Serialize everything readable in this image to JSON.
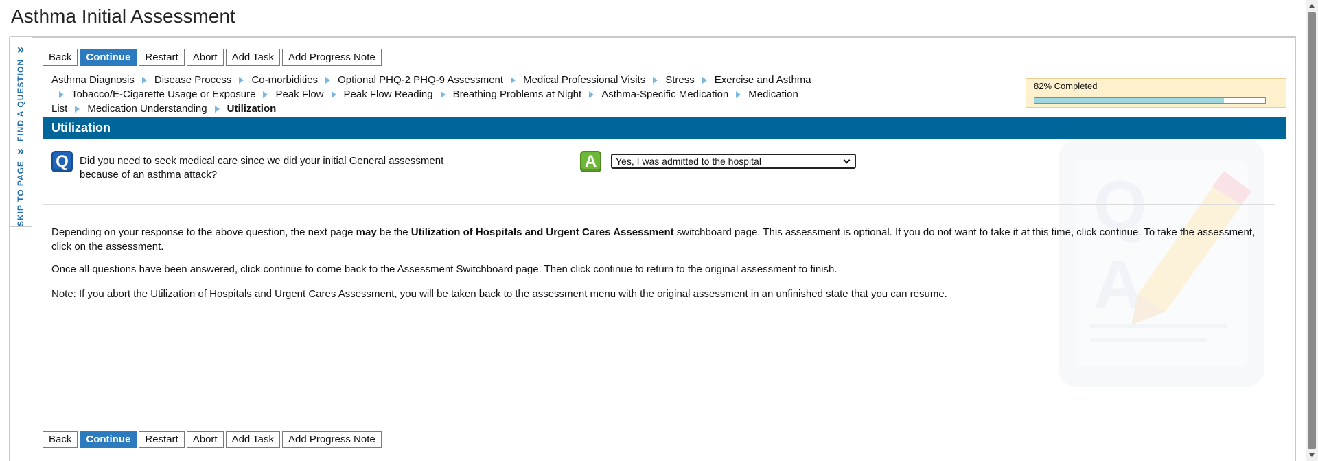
{
  "page": {
    "title": "Asthma Initial Assessment"
  },
  "side_tabs": [
    {
      "label": "FIND A QUESTION"
    },
    {
      "label": "SKIP TO PAGE"
    }
  ],
  "toolbar": {
    "back": "Back",
    "continue": "Continue",
    "restart": "Restart",
    "abort": "Abort",
    "add_task": "Add Task",
    "add_progress_note": "Add Progress Note"
  },
  "breadcrumbs": [
    {
      "label": "Asthma Diagnosis"
    },
    {
      "label": "Disease Process"
    },
    {
      "label": "Co-morbidities"
    },
    {
      "label": "Optional PHQ-2 PHQ-9 Assessment"
    },
    {
      "label": "Medical Professional Visits"
    },
    {
      "label": "Stress"
    },
    {
      "label": "Exercise and Asthma"
    },
    {
      "label": "Tobacco/E-Cigarette Usage or Exposure"
    },
    {
      "label": "Peak Flow"
    },
    {
      "label": "Peak Flow Reading"
    },
    {
      "label": "Breathing Problems at Night"
    },
    {
      "label": "Asthma-Specific Medication"
    },
    {
      "label": "Medication List"
    },
    {
      "label": "Medication Understanding"
    },
    {
      "label": "Utilization"
    }
  ],
  "progress": {
    "label": "82% Completed",
    "percent": 82
  },
  "section": {
    "title": "Utilization"
  },
  "question": {
    "icon_text": "Q",
    "text": "Did you need to seek medical care since we did your initial General assessment because of an asthma attack?"
  },
  "answer": {
    "icon_text": "A",
    "selected": "Yes, I was admitted to the hospital"
  },
  "info": {
    "p1_a": "Depending on your response to the above question, the next page ",
    "p1_b": "may",
    "p1_c": " be the ",
    "p1_d": "Utilization of Hospitals and Urgent Cares Assessment",
    "p1_e": " switchboard page. This assessment is optional. If you do not want to take it at this time, click continue. To take the assessment, click on the assessment.",
    "p2": "Once all questions have been answered, click continue to come back to the Assessment Switchboard page. Then click continue to return to the original assessment to finish.",
    "p3": "Note: If you abort the Utilization of Hospitals and Urgent Cares Assessment, you will be taken back to the assessment menu with the original assessment in an unfinished state that you can resume."
  },
  "colors": {
    "header_bar": "#00669a",
    "primary_button": "#2c7bbf",
    "progress_bg": "#fdf0cd",
    "progress_fill": "#9fd8df",
    "q_icon": "#1f64b8",
    "a_icon": "#6fb738",
    "side_text": "#1f6fb0"
  },
  "icons": [
    "chevron-double-right-icon",
    "q-icon",
    "a-icon",
    "chevron-down-icon",
    "qa-watermark-icon"
  ]
}
